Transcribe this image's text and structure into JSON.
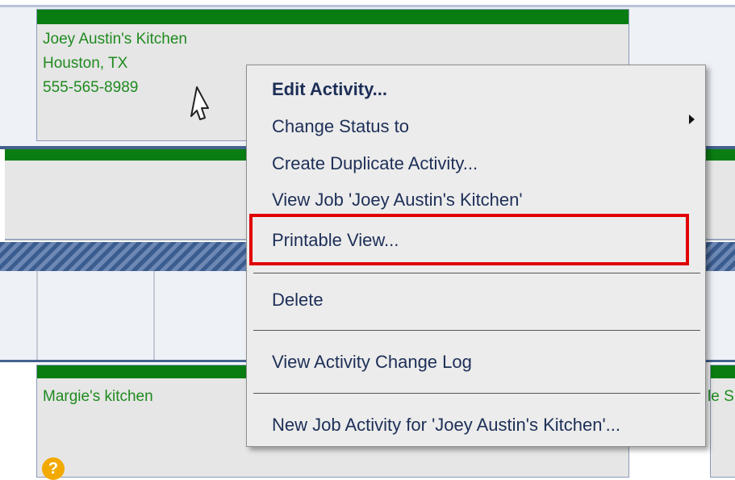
{
  "cards": {
    "top": {
      "name": "Joey Austin's Kitchen",
      "location": "Houston, TX",
      "phone": "555-565-8989"
    },
    "bottom": {
      "name": "Margie's kitchen"
    },
    "right_partial_text": "le S"
  },
  "context_menu": {
    "items": [
      {
        "label": "Edit Activity...",
        "bold": true
      },
      {
        "label": "Change Status to",
        "has_submenu": true
      },
      {
        "label": "Create Duplicate Activity..."
      },
      {
        "label": "View Job 'Joey Austin's Kitchen'"
      },
      {
        "label": "Printable View...",
        "highlighted": true
      },
      {
        "label": "Delete"
      },
      {
        "label": "View Activity Change Log"
      },
      {
        "label": "New Job Activity for 'Joey Austin's Kitchen'..."
      }
    ]
  },
  "colors": {
    "card_text": "#1f8a1f",
    "card_header": "#0a7d12",
    "menu_text": "#1d2f57",
    "highlight_box": "#e00000"
  },
  "icons": [
    "mouse-pointer-icon",
    "submenu-arrow-icon",
    "warning-icon"
  ]
}
